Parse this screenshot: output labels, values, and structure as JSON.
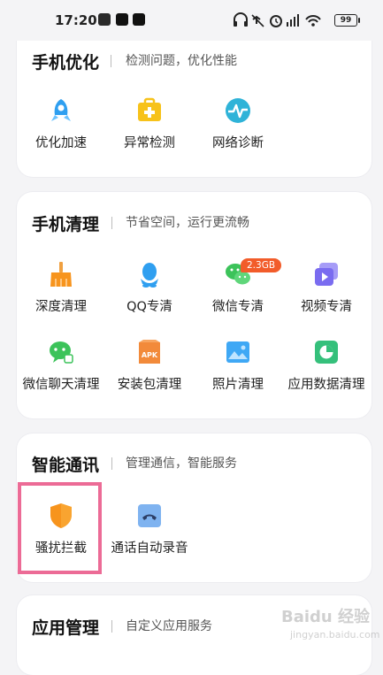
{
  "status_bar": {
    "time": "17:20",
    "battery": "99"
  },
  "sections": [
    {
      "title": "手机优化",
      "subtitle": "检测问题，优化性能",
      "items": [
        {
          "label": "优化加速",
          "icon": "rocket-icon"
        },
        {
          "label": "异常检测",
          "icon": "medical-kit-icon"
        },
        {
          "label": "网络诊断",
          "icon": "network-pulse-icon"
        }
      ]
    },
    {
      "title": "手机清理",
      "subtitle": "节省空间，运行更流畅",
      "items": [
        {
          "label": "深度清理",
          "icon": "broom-icon"
        },
        {
          "label": "QQ专清",
          "icon": "qq-icon"
        },
        {
          "label": "微信专清",
          "icon": "wechat-icon",
          "badge": "2.3GB"
        },
        {
          "label": "视频专清",
          "icon": "video-icon"
        },
        {
          "label": "微信聊天清理",
          "icon": "wechat-chat-icon"
        },
        {
          "label": "安装包清理",
          "icon": "apk-icon",
          "icon_text": "APK"
        },
        {
          "label": "照片清理",
          "icon": "photo-icon"
        },
        {
          "label": "应用数据清理",
          "icon": "app-data-icon"
        }
      ]
    },
    {
      "title": "智能通讯",
      "subtitle": "管理通信，智能服务",
      "items": [
        {
          "label": "骚扰拦截",
          "icon": "shield-icon"
        },
        {
          "label": "通话自动录音",
          "icon": "call-record-icon"
        }
      ]
    },
    {
      "title": "应用管理",
      "subtitle": "自定义应用服务",
      "items": []
    }
  ],
  "watermark": {
    "text": "Baidu 经验",
    "sub": "jingyan.baidu.com"
  },
  "colors": {
    "accent_blue": "#2f9ff0",
    "accent_orange": "#f7941d",
    "wechat_green": "#3cc35a",
    "video_purple": "#7a6cf0",
    "highlight_pink": "#ec6b96",
    "badge_red": "#f25c2a"
  }
}
